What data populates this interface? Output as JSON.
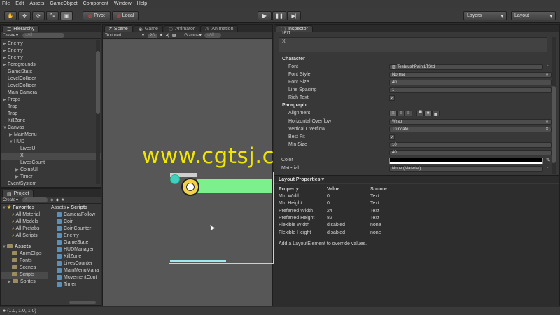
{
  "menu": [
    "File",
    "Edit",
    "Assets",
    "GameObject",
    "Component",
    "Window",
    "Help"
  ],
  "toolbar": {
    "pivot": "Pivot",
    "local": "Local",
    "layers": "Layers",
    "layout": "Layout"
  },
  "hierarchy": {
    "tab": "Hierarchy",
    "create": "Create",
    "search": "All",
    "items": [
      {
        "label": "Enemy",
        "indent": 0,
        "arrow": "▶"
      },
      {
        "label": "Enemy",
        "indent": 0,
        "arrow": "▶"
      },
      {
        "label": "Enemy",
        "indent": 0,
        "arrow": "▶"
      },
      {
        "label": "Foregrounds",
        "indent": 0,
        "arrow": "▶"
      },
      {
        "label": "GameState",
        "indent": 0,
        "arrow": ""
      },
      {
        "label": "LevelCollider",
        "indent": 0,
        "arrow": ""
      },
      {
        "label": "LevelCollider",
        "indent": 0,
        "arrow": ""
      },
      {
        "label": "Main Camera",
        "indent": 0,
        "arrow": ""
      },
      {
        "label": "Props",
        "indent": 0,
        "arrow": "▶"
      },
      {
        "label": "Trap",
        "indent": 0,
        "arrow": ""
      },
      {
        "label": "Trap",
        "indent": 0,
        "arrow": ""
      },
      {
        "label": "KillZone",
        "indent": 0,
        "arrow": ""
      },
      {
        "label": "Canvas",
        "indent": 0,
        "arrow": "▼"
      },
      {
        "label": "MainMenu",
        "indent": 1,
        "arrow": "▶"
      },
      {
        "label": "HUD",
        "indent": 1,
        "arrow": "▼"
      },
      {
        "label": "LivesUI",
        "indent": 2,
        "arrow": ""
      },
      {
        "label": "X",
        "indent": 2,
        "arrow": "",
        "selected": true
      },
      {
        "label": "LivesCount",
        "indent": 2,
        "arrow": ""
      },
      {
        "label": "CoinsUI",
        "indent": 2,
        "arrow": "▶"
      },
      {
        "label": "Timer",
        "indent": 2,
        "arrow": "▶"
      },
      {
        "label": "EventSystem",
        "indent": 0,
        "arrow": ""
      }
    ]
  },
  "project": {
    "tab": "Project",
    "create": "Create",
    "favorites_title": "Favorites",
    "favorites": [
      "All Material",
      "All Models",
      "All Prefabs",
      "All Scripts"
    ],
    "assets_title": "Assets",
    "folders": [
      "AnimClips",
      "Fonts",
      "Scenes",
      "Scripts",
      "Sprites"
    ],
    "breadcrumb_root": "Assets",
    "breadcrumb_leaf": "Scripts",
    "scripts": [
      "CameraFollow",
      "Coin",
      "CoinCounter",
      "Enemy",
      "GameState",
      "HUDManager",
      "KillZone",
      "LivesCounter",
      "MainMenuMana",
      "MovementCont",
      "Timer"
    ]
  },
  "scene": {
    "tabs": [
      "Scene",
      "Game",
      "Animator",
      "Animation"
    ],
    "shading": "Textured",
    "mode": "2D",
    "gizmos": "Gizmos",
    "search": "All",
    "watermark": "www.cgtsj.com"
  },
  "inspector": {
    "tab": "Inspector",
    "text_label": "Text",
    "text_value": "X",
    "character": "Character",
    "font_label": "Font",
    "font_value": "TeebrushPaintLTStd",
    "font_style_label": "Font Style",
    "font_style_value": "Normal",
    "font_size_label": "Font Size",
    "font_size_value": "40",
    "line_spacing_label": "Line Spacing",
    "line_spacing_value": "1",
    "rich_text_label": "Rich Text",
    "paragraph": "Paragraph",
    "alignment_label": "Alignment",
    "h_overflow_label": "Horizontal Overflow",
    "h_overflow_value": "Wrap",
    "v_overflow_label": "Vertical Overflow",
    "v_overflow_value": "Truncate",
    "best_fit_label": "Best Fit",
    "min_size_label": "Min Size",
    "min_size_value": "10",
    "max_size_value": "40",
    "color_label": "Color",
    "material_label": "Material",
    "material_value": "None (Material)",
    "layout_title": "Layout Properties",
    "layout_headers": [
      "Property",
      "Value",
      "Source"
    ],
    "layout_rows": [
      [
        "Min Width",
        "0",
        "Text"
      ],
      [
        "Min Height",
        "0",
        "Text"
      ],
      [
        "Preferred Width",
        "24",
        "Text"
      ],
      [
        "Preferred Height",
        "82",
        "Text"
      ],
      [
        "Flexible Width",
        "disabled",
        "none"
      ],
      [
        "Flexible Height",
        "disabled",
        "none"
      ]
    ],
    "layout_hint": "Add a LayoutElement to override values."
  },
  "status": {
    "text": "(1.0, 1.0, 1.0)"
  },
  "colors": {
    "hud_bar": "#7cf08c",
    "hud_cyan": "#9ee8f0",
    "watermark": "#f2e600"
  }
}
